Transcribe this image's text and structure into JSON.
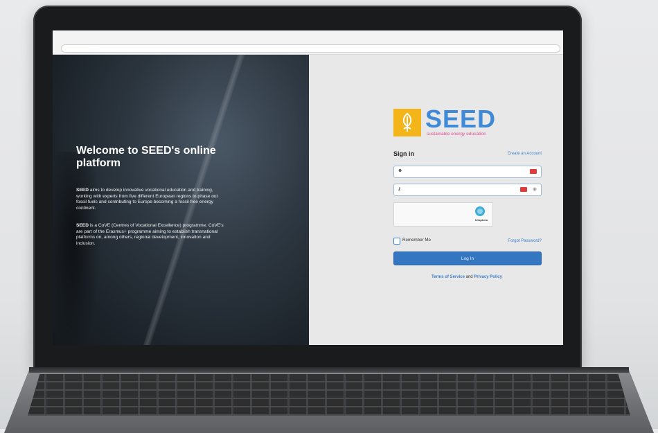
{
  "browser": {
    "url": ""
  },
  "hero": {
    "title": "Welcome to SEED's online platform",
    "p1_strong": "SEED",
    "p1_rest": " aims to develop innovative vocational education and training, working with experts from five different European regions to phase out fossil fuels and contributing to Europe becoming a fossil free energy continent.",
    "p2_strong": "SEED",
    "p2_rest": " is a CoVE (Centres of Vocational Excellence) programme. CoVE's are part of the Erasmus+ programme aiming to establish transnational platforms on, among others, regional development, innovation and inclusion."
  },
  "logo": {
    "word": "SEED",
    "tagline": "sustainable energy education",
    "box_color": "#f4b51b",
    "word_color": "#3f8ad8",
    "tagline_color": "#e24c8a"
  },
  "signin": {
    "title": "Sign in",
    "create_account": "Create an Account",
    "username_value": "",
    "password_value": "",
    "captcha_label": "hCaptcha",
    "remember_label": "Remember Me",
    "forgot_label": "Forgot Password?",
    "login_label": "Log In",
    "terms_link": "Terms of Service",
    "terms_and": " and ",
    "privacy_link": "Privacy Policy",
    "accent": "#3576c0"
  },
  "icons": {
    "user": "user-icon",
    "key": "key-icon",
    "eye": "eye-icon",
    "captcha": "hcaptcha-logo-icon",
    "logo": "seed-leaf-icon"
  }
}
